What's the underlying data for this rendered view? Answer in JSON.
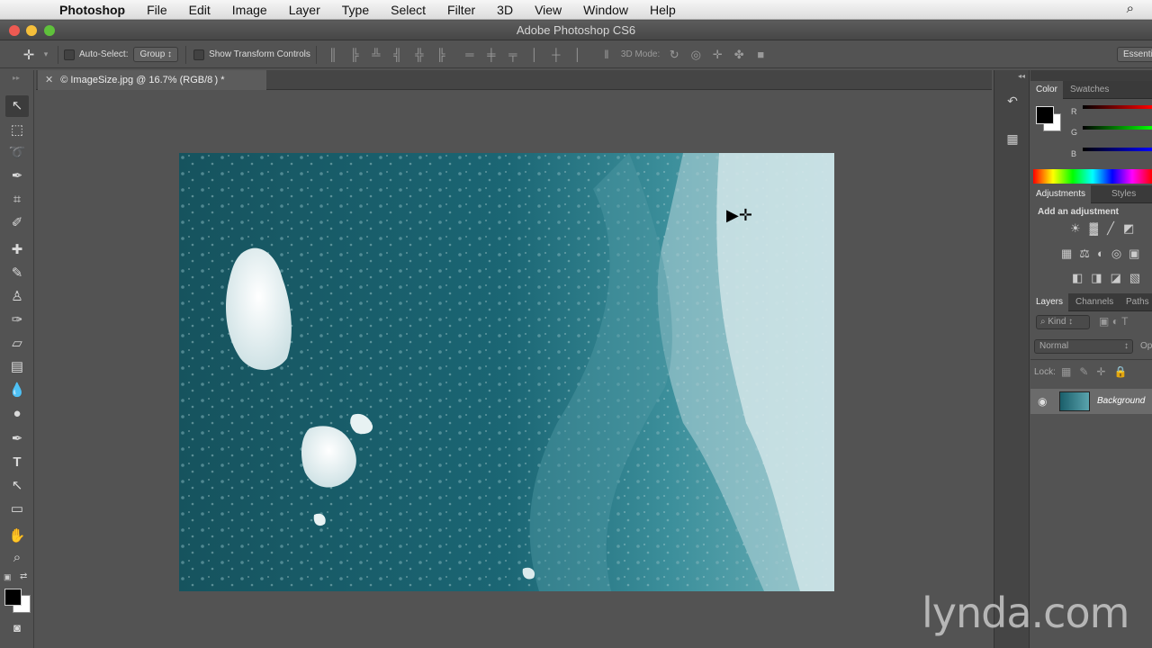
{
  "menubar": {
    "apple": "",
    "app": "Photoshop",
    "items": [
      "File",
      "Edit",
      "Image",
      "Layer",
      "Type",
      "Select",
      "Filter",
      "3D",
      "View",
      "Window",
      "Help"
    ]
  },
  "title": "Adobe Photoshop CS6",
  "options": {
    "auto_select_label": "Auto-Select:",
    "group_value": "Group",
    "transform_label": "Show Transform Controls",
    "mode3d_label": "3D Mode:",
    "workspace": "Essentia"
  },
  "doc": {
    "tab_title": "© ImageSize.jpg @ 16.7% (RGB/8 ) *"
  },
  "panels": {
    "color_tabs": [
      "Color",
      "Swatches"
    ],
    "rgb_labels": [
      "R",
      "G",
      "B"
    ],
    "adj_tabs": [
      "Adjustments",
      "Styles"
    ],
    "adj_heading": "Add an adjustment",
    "layer_tabs": [
      "Layers",
      "Channels",
      "Paths"
    ],
    "kind": "Kind",
    "blend": "Normal",
    "opacity_label": "Op",
    "lock_label": "Lock:",
    "layer_name": "Background"
  },
  "watermark": "lynda.com"
}
